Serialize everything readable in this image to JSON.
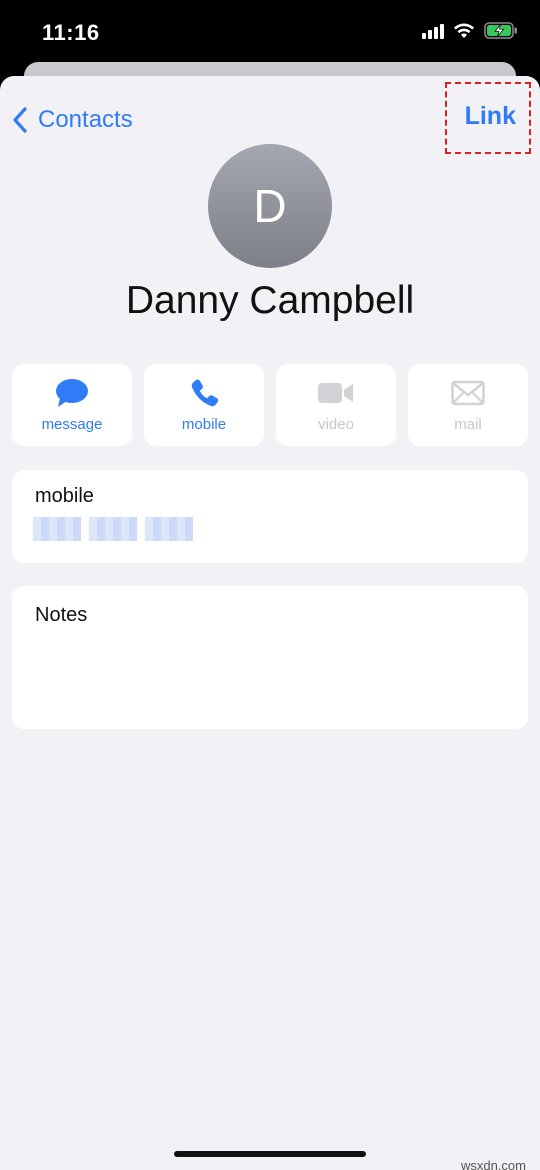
{
  "status_bar": {
    "time": "11:16",
    "icons": [
      "signal-icon",
      "wifi-icon",
      "battery-charging-icon"
    ]
  },
  "nav": {
    "back_label": "Contacts",
    "link_label": "Link"
  },
  "contact": {
    "initial": "D",
    "name": "Danny Campbell"
  },
  "actions": [
    {
      "label": "message",
      "icon": "message-bubble-icon",
      "enabled": true
    },
    {
      "label": "mobile",
      "icon": "phone-icon",
      "enabled": true
    },
    {
      "label": "video",
      "icon": "video-camera-icon",
      "enabled": false
    },
    {
      "label": "mail",
      "icon": "envelope-icon",
      "enabled": false
    }
  ],
  "mobile_card": {
    "label": "mobile"
  },
  "notes_card": {
    "label": "Notes"
  },
  "watermark": "wsxdn.com",
  "colors": {
    "accent": "#2f7cf6",
    "disabled": "#c7c7cc",
    "background": "#f1f1f6",
    "annotation": "#e02020"
  }
}
